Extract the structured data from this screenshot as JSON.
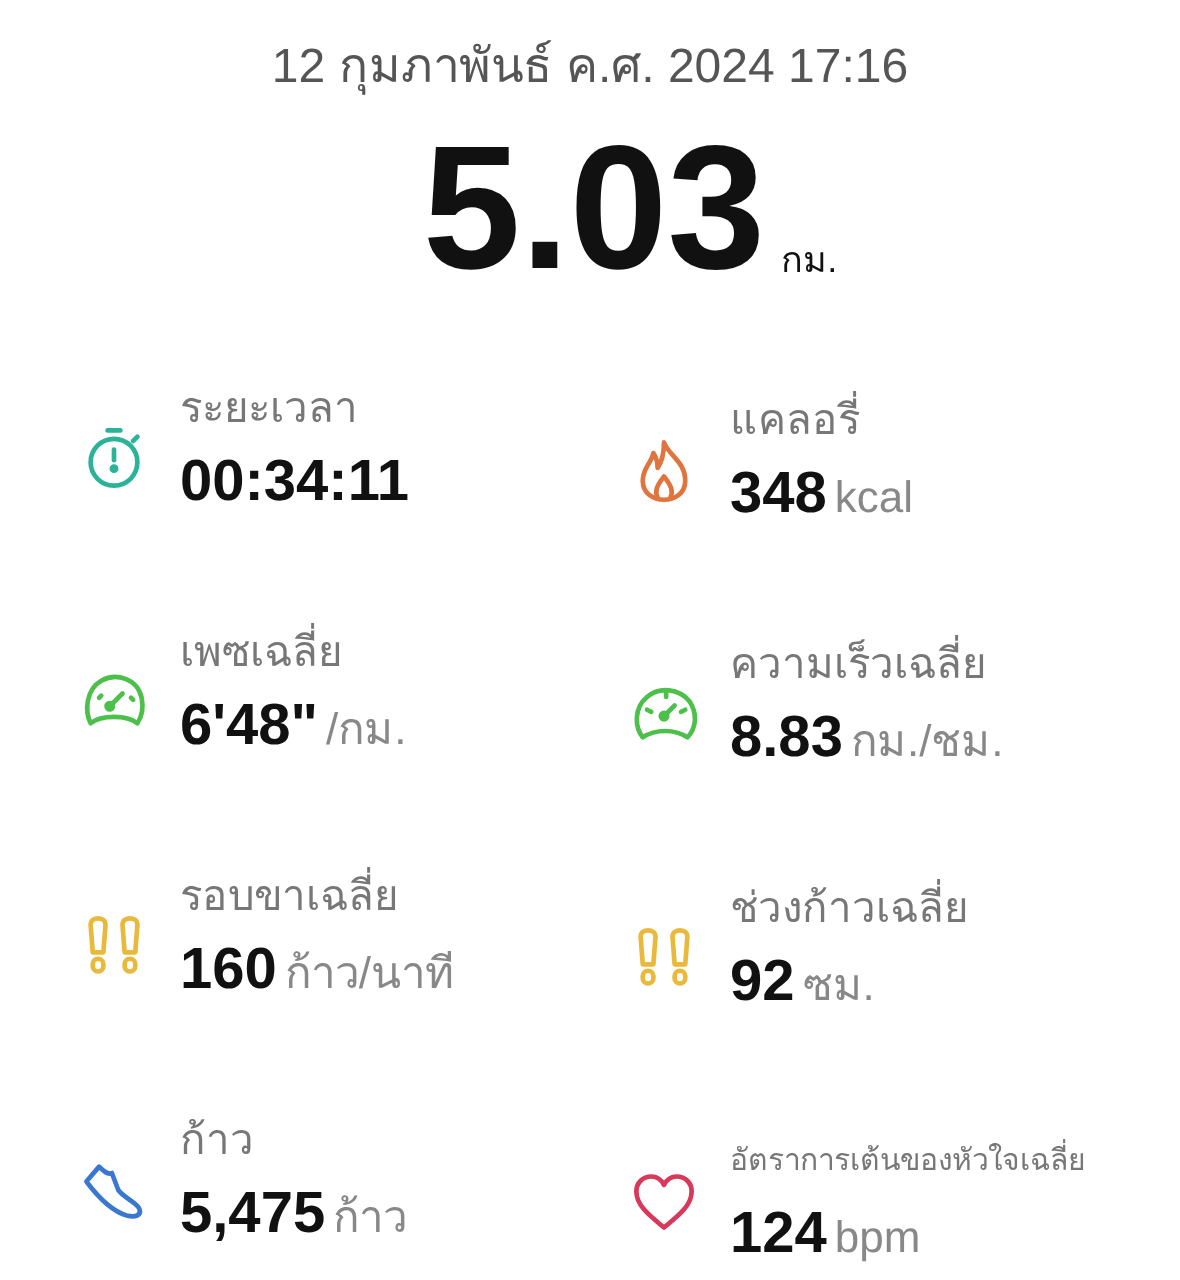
{
  "date": "12 กุมภาพันธ์ ค.ศ. 2024 17:16",
  "distance": {
    "value": "5.03",
    "unit": "กม."
  },
  "metrics": [
    {
      "kind": "stopwatch",
      "color": "#2bb39a",
      "label": "ระยะเวลา",
      "value": "00:34:11"
    },
    {
      "kind": "flame",
      "color": "#e0743f",
      "label": "แคลอรี่",
      "value": "348",
      "unit": "kcal"
    },
    {
      "kind": "gauge",
      "color": "#4cc04a",
      "label": "เพซเฉลี่ย",
      "value": "6'48\"",
      "unit": "/กม."
    },
    {
      "kind": "speedometer",
      "color": "#4cc04a",
      "label": "ความเร็วเฉลี่ย",
      "value": "8.83",
      "unit": "กม./ชม."
    },
    {
      "kind": "footprints",
      "color": "#e8b93a",
      "label": "รอบขาเฉลี่ย",
      "value": "160",
      "unit": "ก้าว/นาที"
    },
    {
      "kind": "footprints",
      "color": "#e8b93a",
      "label": "ช่วงก้าวเฉลี่ย",
      "value": "92",
      "unit": "ซม."
    },
    {
      "kind": "shoe",
      "color": "#3a78d0",
      "label": "ก้าว",
      "value": "5,475",
      "unit": "ก้าว"
    },
    {
      "kind": "heart",
      "color": "#d8385a",
      "label": "อัตราการเต้นของหัวใจเฉลี่ย",
      "value": "124",
      "unit": "bpm",
      "small_label": true
    }
  ]
}
